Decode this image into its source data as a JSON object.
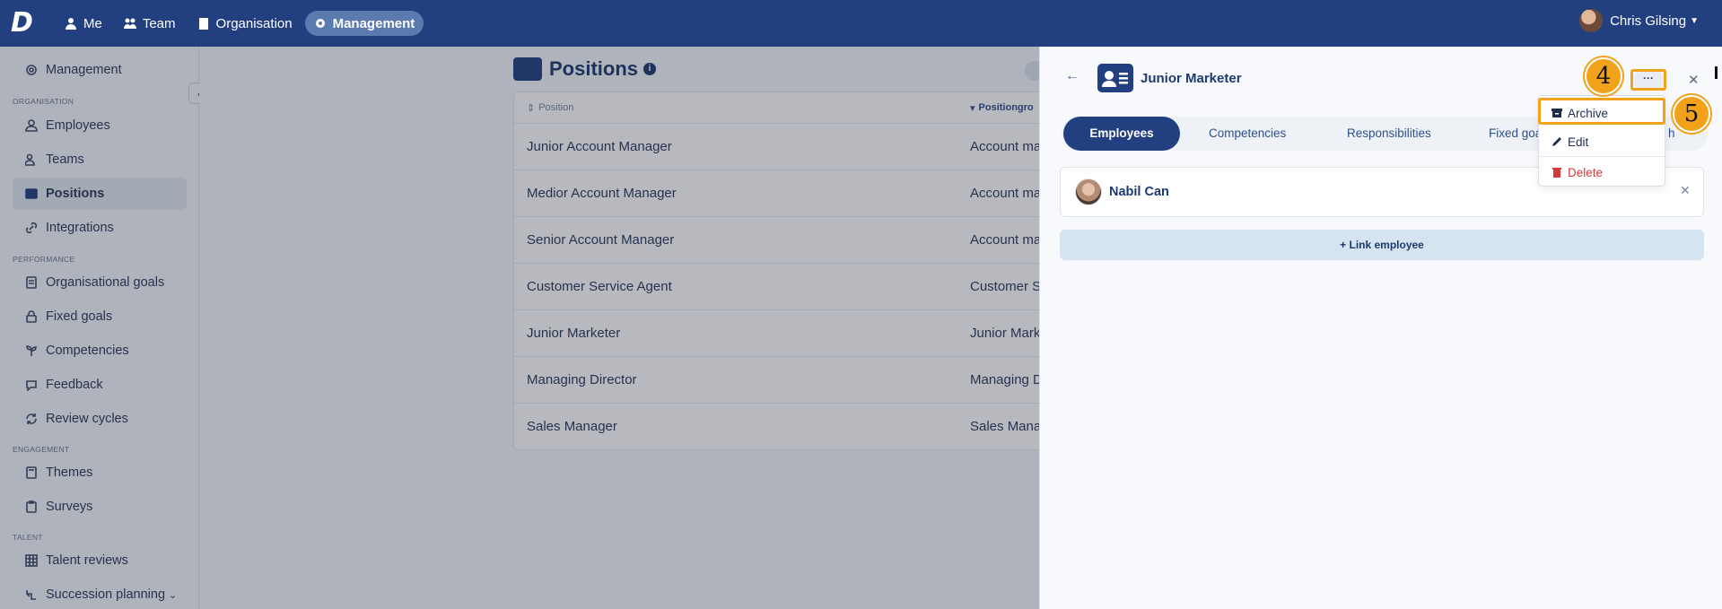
{
  "topbar": {
    "logo": "D",
    "nav": [
      {
        "label": "Me",
        "icon": "person-icon"
      },
      {
        "label": "Team",
        "icon": "team-icon"
      },
      {
        "label": "Organisation",
        "icon": "building-icon"
      },
      {
        "label": "Management",
        "icon": "gear-icon"
      }
    ],
    "user_name": "Chris Gilsing"
  },
  "sidebar": {
    "top_item": "Management",
    "sections": {
      "organisation": "ORGANISATION",
      "performance": "PERFORMANCE",
      "engagement": "ENGAGEMENT",
      "talent": "TALENT"
    },
    "items": {
      "employees": "Employees",
      "teams": "Teams",
      "positions": "Positions",
      "integrations": "Integrations",
      "org_goals": "Organisational goals",
      "fixed_goals": "Fixed goals",
      "competencies": "Competencies",
      "feedback": "Feedback",
      "review_cycles": "Review cycles",
      "themes": "Themes",
      "surveys": "Surveys",
      "talent_reviews": "Talent reviews",
      "succession": "Succession planning"
    }
  },
  "main": {
    "title": "Positions",
    "columns": {
      "position": "Position",
      "group": "Positiongro"
    },
    "rows": [
      {
        "position": "Junior Account Manager",
        "group": "Account ma"
      },
      {
        "position": "Medior Account Manager",
        "group": "Account ma"
      },
      {
        "position": "Senior Account Manager",
        "group": "Account ma"
      },
      {
        "position": "Customer Service Agent",
        "group": "Customer S"
      },
      {
        "position": "Junior Marketer",
        "group": "Junior Mark"
      },
      {
        "position": "Managing Director",
        "group": "Managing D"
      },
      {
        "position": "Sales Manager",
        "group": "Sales Mana"
      }
    ]
  },
  "drawer": {
    "title": "Junior Marketer",
    "more_label": "···",
    "tabs": [
      "Employees",
      "Competencies",
      "Responsibilities",
      "Fixed goa",
      "h"
    ],
    "employee_name": "Nabil Can",
    "link_button": "+ Link employee"
  },
  "dropdown": {
    "archive": "Archive",
    "edit": "Edit",
    "delete": "Delete"
  },
  "steps": {
    "four": "4",
    "five": "5"
  },
  "colors": {
    "brand": "#22407f",
    "highlight": "#f2a21a",
    "danger": "#d23a3a"
  }
}
